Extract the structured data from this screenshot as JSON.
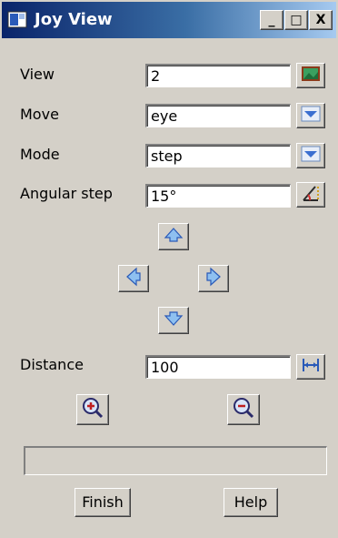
{
  "window": {
    "title": "Joy View",
    "minimize_label": "_",
    "maximize_label": "□",
    "close_label": "X"
  },
  "fields": {
    "view": {
      "label": "View",
      "value": "2",
      "button_icon": "view-picture-icon"
    },
    "move": {
      "label": "Move",
      "value": "eye",
      "button_icon": "chevron-down-icon"
    },
    "mode": {
      "label": "Mode",
      "value": "step",
      "button_icon": "chevron-down-icon"
    },
    "angular_step": {
      "label": "Angular step",
      "value": "15°",
      "button_icon": "angle-pick-icon"
    },
    "distance": {
      "label": "Distance",
      "value": "100",
      "button_icon": "measure-distance-icon"
    }
  },
  "arrows": [
    "arrow-up-icon",
    "arrow-left-icon",
    "arrow-right-icon",
    "arrow-down-icon"
  ],
  "zoom": [
    "zoom-in-icon",
    "zoom-out-icon"
  ],
  "status": {
    "text": ""
  },
  "buttons": {
    "finish": "Finish",
    "help": "Help"
  },
  "colors": {
    "title_start": "#0a246a",
    "title_end": "#a6caf0",
    "face": "#d4d0c8",
    "icon_blue": "#5a8fd8"
  }
}
